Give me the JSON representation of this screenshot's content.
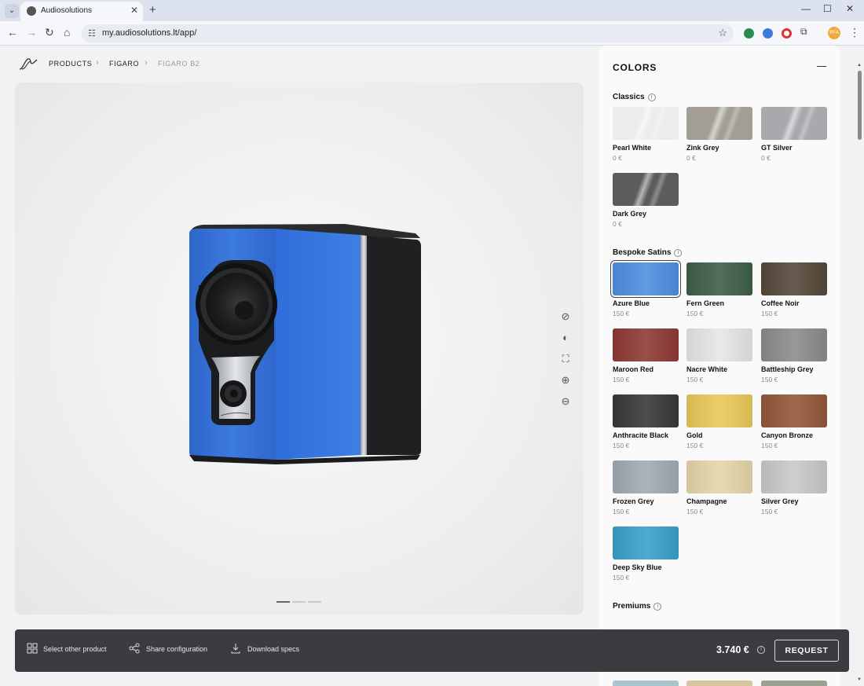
{
  "browser": {
    "tab_title": "Audiosolutions",
    "url": "my.audiosolutions.lt/app/",
    "profile_initials": "RFA"
  },
  "breadcrumb": [
    "PRODUCTS",
    "FIGARO",
    "FIGARO B2"
  ],
  "panel": {
    "title": "COLORS",
    "sections": [
      {
        "title": "Classics",
        "swatches": [
          {
            "name": "Pearl White",
            "price": "0 €",
            "color": "#ececec",
            "finish": "gloss"
          },
          {
            "name": "Zink Grey",
            "price": "0 €",
            "color": "#a29e93",
            "finish": "gloss"
          },
          {
            "name": "GT Silver",
            "price": "0 €",
            "color": "#a9a9ad",
            "finish": "gloss"
          },
          {
            "name": "Dark Grey",
            "price": "0 €",
            "color": "#5b5c5e",
            "finish": "gloss"
          }
        ]
      },
      {
        "title": "Bespoke Satins",
        "swatches": [
          {
            "name": "Azure Blue",
            "price": "150 €",
            "color": "#4f8fe0",
            "finish": "matte",
            "selected": true
          },
          {
            "name": "Fern Green",
            "price": "150 €",
            "color": "#3f5f48",
            "finish": "matte"
          },
          {
            "name": "Coffee Noir",
            "price": "150 €",
            "color": "#55493a",
            "finish": "matte"
          },
          {
            "name": "Maroon Red",
            "price": "150 €",
            "color": "#8e3a35",
            "finish": "matte"
          },
          {
            "name": "Nacre White",
            "price": "150 €",
            "color": "#e6e6e6",
            "finish": "matte"
          },
          {
            "name": "Battleship Grey",
            "price": "150 €",
            "color": "#8b8c8e",
            "finish": "matte"
          },
          {
            "name": "Anthracite Black",
            "price": "150 €",
            "color": "#38393b",
            "finish": "matte"
          },
          {
            "name": "Gold",
            "price": "150 €",
            "color": "#e9c95a",
            "finish": "matte"
          },
          {
            "name": "Canyon Bronze",
            "price": "150 €",
            "color": "#93583a",
            "finish": "matte"
          },
          {
            "name": "Frozen Grey",
            "price": "150 €",
            "color": "#a2abb2",
            "finish": "matte"
          },
          {
            "name": "Champagne",
            "price": "150 €",
            "color": "#e5d6a9",
            "finish": "matte"
          },
          {
            "name": "Silver Grey",
            "price": "150 €",
            "color": "#c9c9c9",
            "finish": "matte"
          },
          {
            "name": "Deep Sky Blue",
            "price": "150 €",
            "color": "#3aa0c8",
            "finish": "matte"
          }
        ]
      },
      {
        "title": "Premiums",
        "swatches": []
      }
    ]
  },
  "bottom_bar": {
    "select_product": "Select other product",
    "share": "Share configuration",
    "download": "Download specs",
    "price": "3.740 €",
    "request": "REQUEST"
  }
}
